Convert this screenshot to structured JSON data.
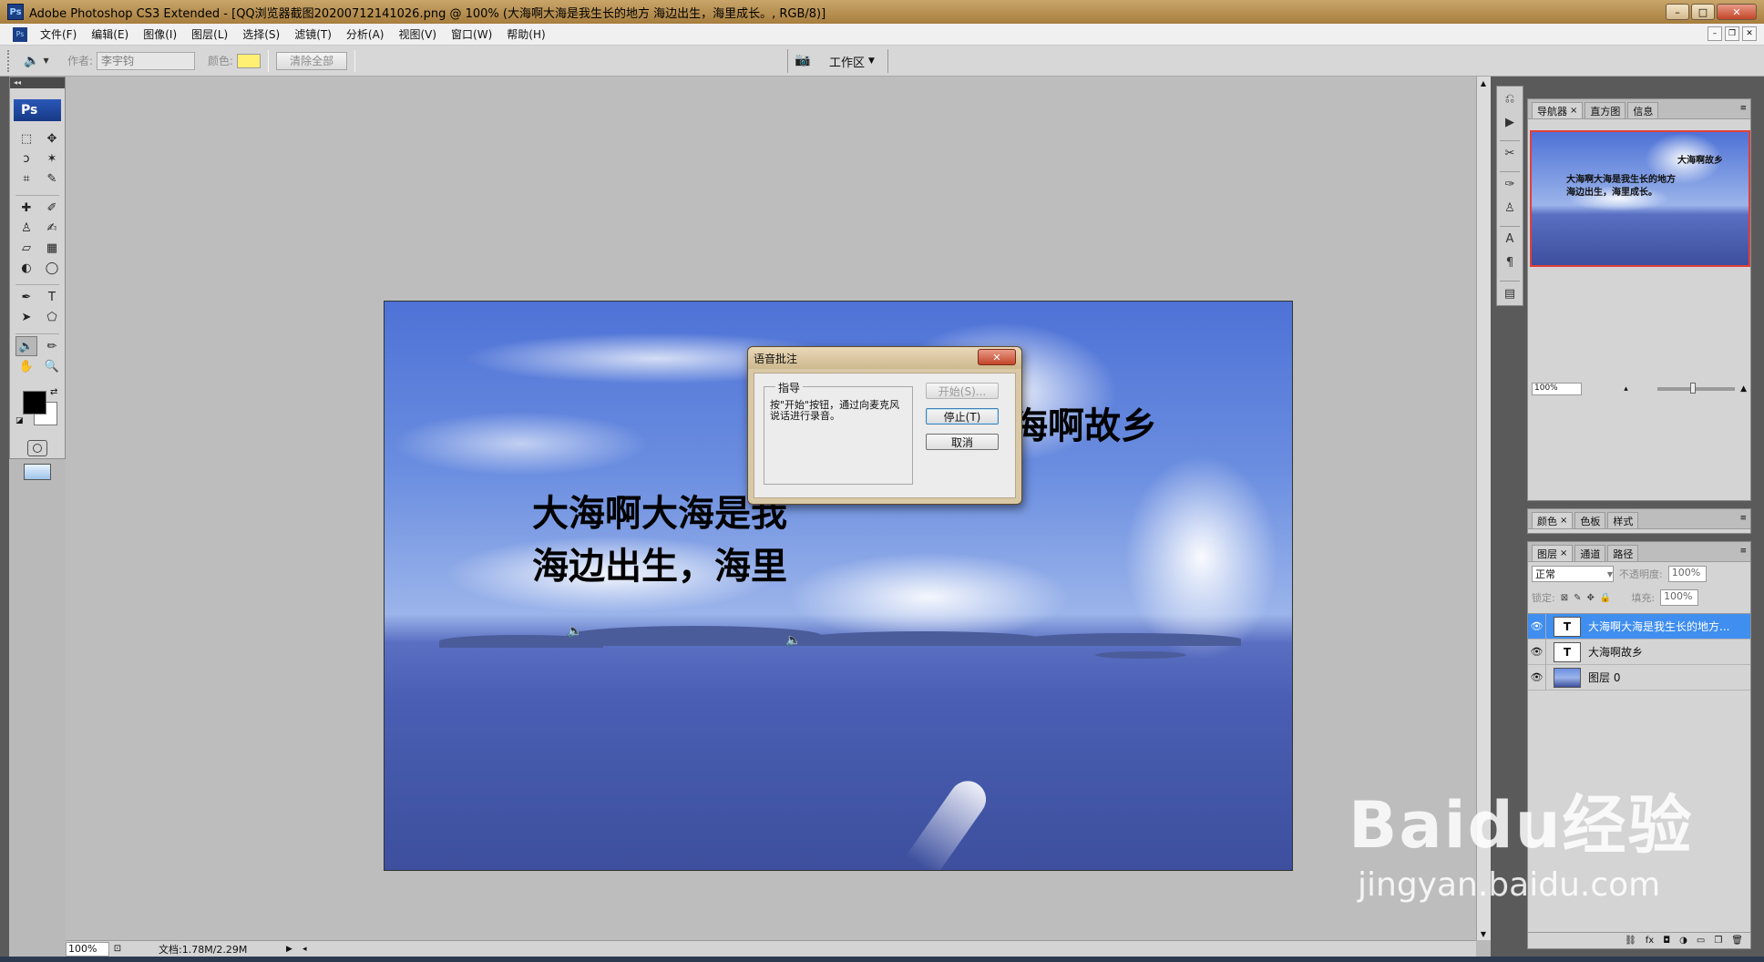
{
  "window": {
    "title": "Adobe Photoshop CS3 Extended - [QQ浏览器截图20200712141026.png @ 100% (大海啊大海是我生长的地方 海边出生，海里成长。, RGB/8)]",
    "app_icon": "Ps"
  },
  "menu": [
    "文件(F)",
    "编辑(E)",
    "图像(I)",
    "图层(L)",
    "选择(S)",
    "滤镜(T)",
    "分析(A)",
    "视图(V)",
    "窗口(W)",
    "帮助(H)"
  ],
  "options": {
    "author_label": "作者:",
    "author_value": "李宇钧",
    "color_label": "颜色:",
    "color_value": "#ffef73",
    "clear_all": "清除全部",
    "workspace": "工作区"
  },
  "toolbox": {
    "logo": "Ps"
  },
  "canvas": {
    "text1_line1": "大海啊大海是我",
    "text1_line2": "海边出生，海里",
    "text2": "大海啊故乡"
  },
  "dialog": {
    "title": "语音批注",
    "group_label": "指导",
    "instructions": "按\"开始\"按钮，通过向麦克风说话进行录音。",
    "start": "开始(S)...",
    "stop": "停止(T)",
    "cancel": "取消"
  },
  "status": {
    "zoom": "100%",
    "doc": "文档:1.78M/2.29M"
  },
  "navigator": {
    "tabs": [
      "导航器",
      "直方图",
      "信息"
    ],
    "thumb_text1": "大海啊故乡",
    "thumb_text2_line1": "大海啊大海是我生长的地方",
    "thumb_text2_line2": "海边出生，海里成长。",
    "zoom": "100%"
  },
  "color_panel": {
    "tabs": [
      "颜色",
      "色板",
      "样式"
    ]
  },
  "layers_panel": {
    "tabs": [
      "图层",
      "通道",
      "路径"
    ],
    "blend_mode": "正常",
    "opacity_label": "不透明度:",
    "opacity": "100%",
    "lock_label": "锁定:",
    "fill_label": "填充:",
    "fill": "100%",
    "layers": [
      {
        "name": "大海啊大海是我生长的地方...",
        "type": "T",
        "selected": true
      },
      {
        "name": "大海啊故乡",
        "type": "T",
        "selected": false
      },
      {
        "name": "图层 0",
        "type": "image",
        "selected": false
      }
    ]
  },
  "watermark": {
    "line1": "Baidu经验",
    "line2": "jingyan.baidu.com"
  }
}
